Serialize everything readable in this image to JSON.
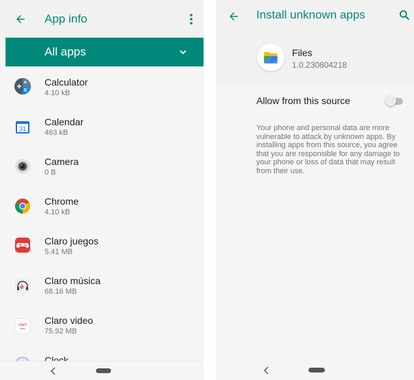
{
  "left": {
    "title": "App info",
    "filter_label": "All apps",
    "apps": [
      {
        "name": "Calculator",
        "size": "4.10 kB",
        "icon": "calculator-icon"
      },
      {
        "name": "Calendar",
        "size": "463 kB",
        "icon": "calendar-icon",
        "icon_text": "31"
      },
      {
        "name": "Camera",
        "size": "0 B",
        "icon": "camera-icon"
      },
      {
        "name": "Chrome",
        "size": "4.10 kB",
        "icon": "chrome-icon"
      },
      {
        "name": "Claro juegos",
        "size": "5.41 MB",
        "icon": "gamepad-icon"
      },
      {
        "name": "Claro música",
        "size": "68.16 MB",
        "icon": "headphones-icon"
      },
      {
        "name": "Claro video",
        "size": "75.92 MB",
        "icon": "claro-video-icon",
        "icon_text": "claro video"
      },
      {
        "name": "Clock",
        "size": "",
        "icon": "clock-icon"
      }
    ]
  },
  "right": {
    "title": "Install unknown apps",
    "app_name": "Files",
    "app_version": "1.0.230804218",
    "allow_label": "Allow from this source",
    "allow_enabled": false,
    "warning": "Your phone and personal data are more vulnerable to attack by unknown apps. By installing apps from this source, you agree that you are responsible for any damage to your phone or loss of data that may result from their use."
  },
  "colors": {
    "accent": "#00897b",
    "background": "#f5f5f5",
    "primary_text": "#212121",
    "secondary_text": "#757575"
  }
}
